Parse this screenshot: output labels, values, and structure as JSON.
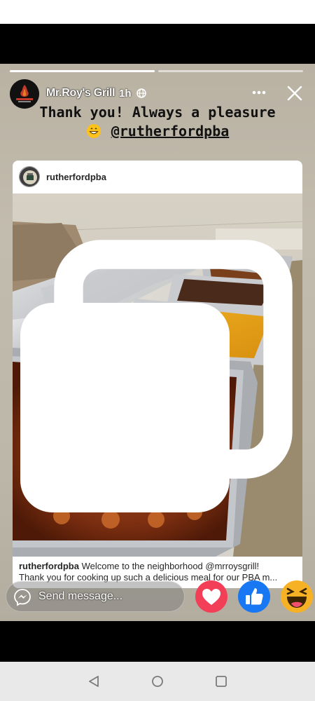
{
  "story": {
    "user_name": "Mr.Roy's Grill",
    "time_ago": "1h",
    "caption_line1": "Thank you! Always a pleasure",
    "caption_mention": "@rutherfordpba",
    "avatar_logo_text": "MR.ROY'S GRILL",
    "progress": [
      1.0,
      0.0
    ]
  },
  "post": {
    "username": "rutherfordpba",
    "caption_user": "rutherfordpba",
    "caption_line1": " Welcome to the neighborhood @mrroysgrill!",
    "caption_line2": "Thank you for cooking up such a delicious meal for our PBA m..."
  },
  "reply": {
    "send_label": "Send message..."
  },
  "reactions": [
    "love",
    "like",
    "haha"
  ],
  "icons": [
    "globe-icon",
    "more-icon",
    "close-icon",
    "messenger-icon",
    "back-icon",
    "home-icon",
    "recents-icon"
  ],
  "colors": {
    "love": "#f33e58",
    "like": "#1877f2",
    "haha": "#f7b125",
    "nav": "#e9e9e9"
  }
}
